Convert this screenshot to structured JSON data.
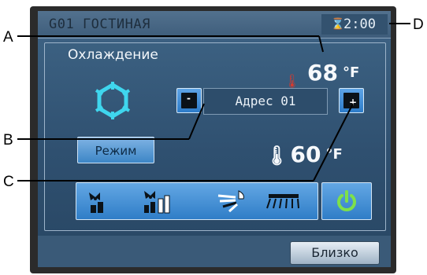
{
  "header": {
    "room_name": "G01 ГОСТИНАЯ",
    "timer": "2:00",
    "timer_icon": "hourglass-icon"
  },
  "mode": {
    "label": "Охлаждение",
    "icon": "snowflake-icon",
    "button_label": "Режим"
  },
  "set_temperature": {
    "value": "68",
    "unit": "°F"
  },
  "room_temperature": {
    "value": "60",
    "unit": "°F"
  },
  "address": {
    "label": "Адрес 01",
    "prev_sign": "-",
    "next_sign": "+"
  },
  "fan": {
    "icons": [
      "fan-low-icon",
      "fan-speed-icon",
      "vane-swing-icon",
      "louver-icon"
    ]
  },
  "power": {
    "icon": "power-icon",
    "accent": "#7ee04a"
  },
  "footer": {
    "close_label": "Близко"
  },
  "callouts": {
    "a": "A",
    "b": "B",
    "c": "C",
    "d": "D"
  },
  "colors": {
    "screen": "#2f5070",
    "button": "#3d86c6",
    "thermometer": "#d83a2e"
  }
}
